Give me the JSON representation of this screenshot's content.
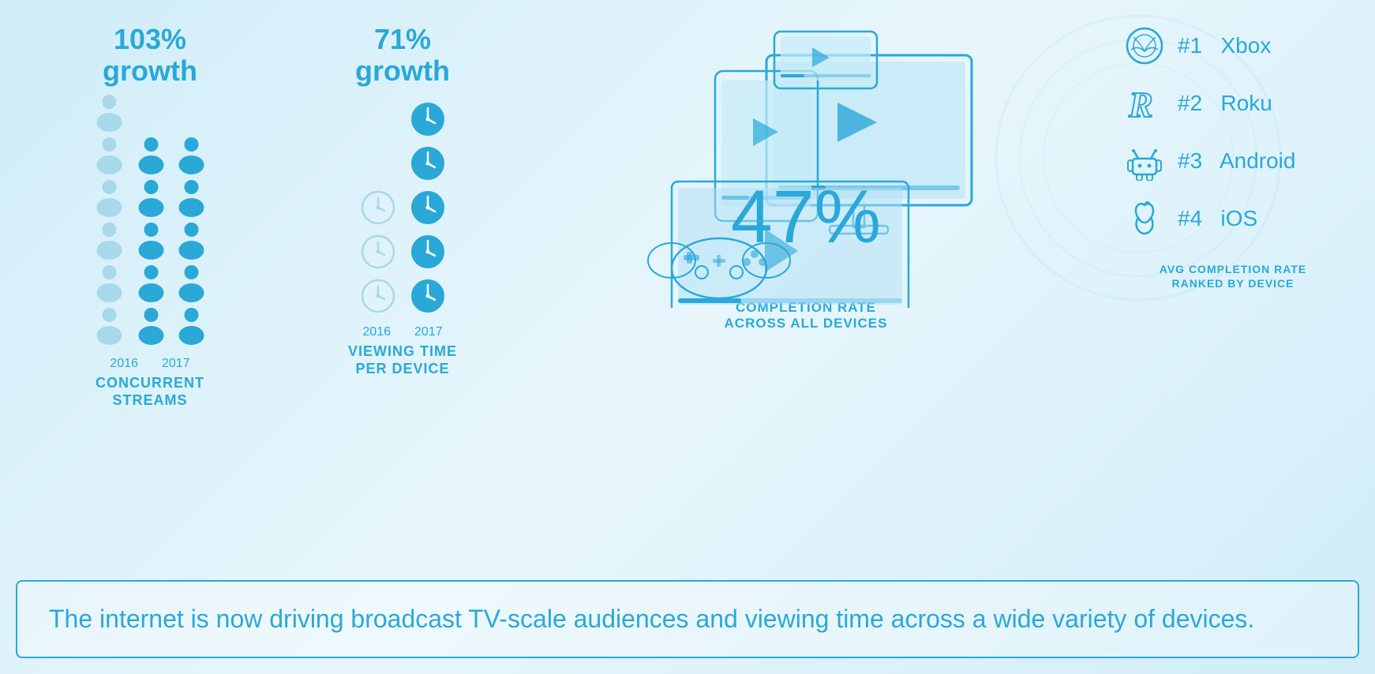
{
  "concurrent": {
    "growth": "103%",
    "growth_word": "growth",
    "year_2016": "2016",
    "year_2017": "2017",
    "label_line1": "CONCURRENT",
    "label_line2": "STREAMS",
    "people_2016": 6,
    "people_2017": 10
  },
  "viewing": {
    "growth": "71%",
    "growth_word": "growth",
    "year_2016": "2016",
    "year_2017": "2017",
    "label_line1": "VIEWING TIME",
    "label_line2": "PER DEVICE",
    "clocks_2016": 3,
    "clocks_2017": 5
  },
  "completion": {
    "rate": "47%",
    "label_line1": "COMPLETION RATE",
    "label_line2": "ACROSS ALL DEVICES"
  },
  "ranked": {
    "title_line1": "AVG COMPLETION RATE",
    "title_line2": "RANKED BY DEVICE",
    "devices": [
      {
        "rank": "#1",
        "name": "Xbox",
        "icon": "xbox"
      },
      {
        "rank": "#2",
        "name": "Roku",
        "icon": "roku"
      },
      {
        "rank": "#3",
        "name": "Android",
        "icon": "android"
      },
      {
        "rank": "#4",
        "name": "iOS",
        "icon": "ios"
      }
    ]
  },
  "bottom": {
    "text": "The internet is now driving broadcast TV-scale audiences and viewing time across a wide variety of devices."
  },
  "colors": {
    "primary": "#2aa8d8",
    "light": "#a8d8ea",
    "bg": "#d0edf8"
  }
}
